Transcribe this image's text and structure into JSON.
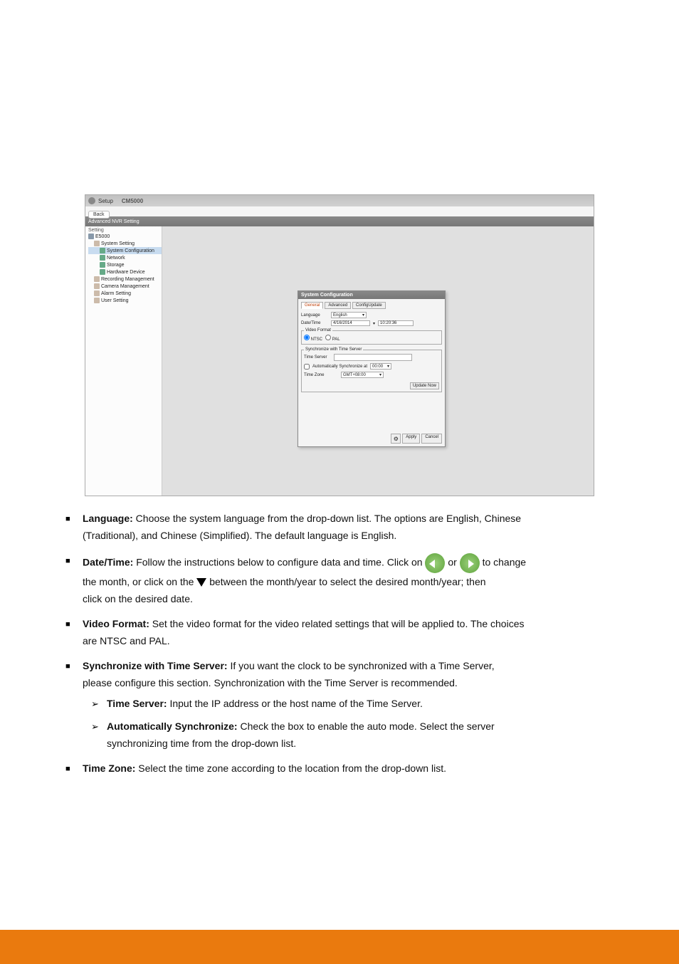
{
  "screenshot": {
    "titlebar": {
      "setup": "Setup"
    },
    "logo": "CM5000",
    "backbtn": "Back",
    "tab": "Advanced NVR Setting",
    "sidebar": {
      "label": "Setting",
      "root": "E5000",
      "system_setting": "System Setting",
      "system_config": "System Configuration",
      "network": "Network",
      "storage": "Storage",
      "hardware_device": "Hardware Device",
      "recording_mgmt": "Recording Management",
      "camera_mgmt": "Camera Management",
      "alarm_setting": "Alarm Setting",
      "user_setting": "User Setting"
    },
    "dialog": {
      "title": "System Configuration",
      "tab_general": "General",
      "tab_advanced": "Advanced",
      "tab_config": "ConfigUpdate",
      "language_label": "Language",
      "language_value": "English",
      "datetime_label": "Date/Time",
      "date_value": "4/16/2014",
      "time_value": "10:20:36",
      "video_format_label": "Video Format",
      "ntsc": "NTSC",
      "pal": "PAL",
      "sync_label": "Synchronize with Time Server",
      "time_server_label": "Time Server",
      "auto_sync_label": "Automatically Synchronize at",
      "auto_sync_value": "00:00",
      "time_zone_label": "Time Zone",
      "time_zone_value": "GMT+08:00",
      "update_now": "Update Now",
      "apply": "Apply",
      "cancel": "Cancel"
    }
  },
  "text": {
    "l1a": "Language:",
    "l1b": " Choose the system language from the drop-down list. The options are English, Chinese",
    "l1c": "(Traditional), and Chinese (Simplified). The default language is English.",
    "l2a": "Date/Time:",
    "l2b": " Follow the instructions below to configure data and time. Click on             or             to change",
    "l2_inline_or": " or ",
    "l2_end": " to change",
    "l2c": "the month, or click on the         between the month/year to select the desired month/year; then",
    "l2d": "click on the desired date.",
    "l3a": "Video Format:",
    "l3b": " Set the video format for the video related settings that will be applied to. The choices",
    "l3c": "are NTSC and PAL.",
    "l4a": "Synchronize with Time Server:",
    "l4b": " If you want the clock to be synchronized with a Time Server,",
    "l4c": "please configure this section. Synchronization with the Time Server is recommended.",
    "l5a": "Time Server:",
    "l5b": " Input the IP address or the host name of the Time Server.",
    "l6a": "Automatically Synchronize:",
    "l6b": " Check the box to enable the auto mode. Select the server",
    "l6c": "synchronizing time from the drop-down list.",
    "l7a": "Time Zone:",
    "l7b": " Select the time zone according to the location from the drop-down list."
  }
}
